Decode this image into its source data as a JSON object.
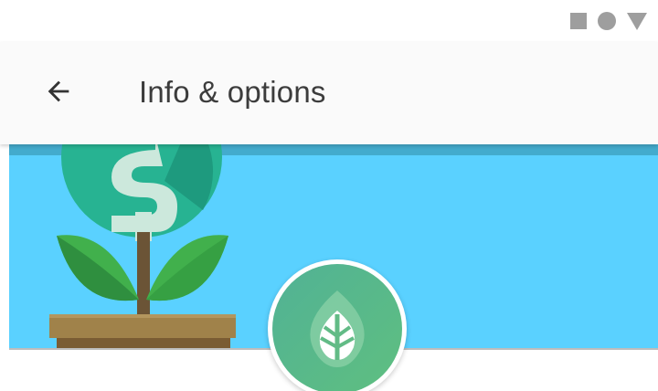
{
  "status_bar": {
    "icons": [
      "square-icon",
      "circle-icon",
      "triangle-icon"
    ],
    "color": "#9e9e9e"
  },
  "app_bar": {
    "title": "Info & options",
    "back_icon": "arrow-back-icon",
    "background": "#fafafa"
  },
  "banner": {
    "background": "#5ad1ff",
    "illustration": "money-plant-icon"
  },
  "app_icon": {
    "icon": "leaf-icon",
    "color": "#5fbf80"
  }
}
